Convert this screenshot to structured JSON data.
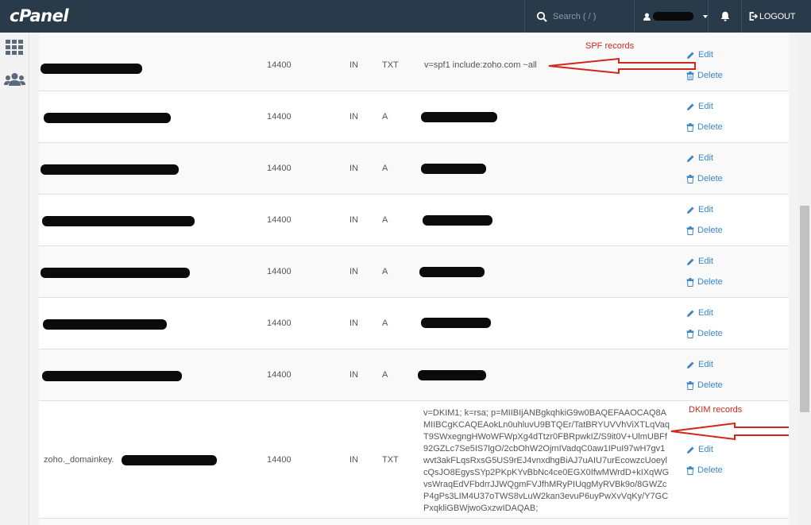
{
  "header": {
    "logo": "cPanel",
    "search_placeholder": "Search ( / )",
    "logout_label": "LOGOUT"
  },
  "sidebar": {
    "items": [
      "apps-grid-icon",
      "users-icon"
    ]
  },
  "actions": {
    "edit": "Edit",
    "delete": "Delete"
  },
  "annotations": {
    "spf": "SPF records",
    "dkim": "DKIM records"
  },
  "records": [
    {
      "name": "",
      "ttl": "14400",
      "class": "IN",
      "type": "TXT",
      "value": "v=spf1 include:zoho.com ~all"
    },
    {
      "name": "",
      "ttl": "14400",
      "class": "IN",
      "type": "A",
      "value": ""
    },
    {
      "name": "",
      "ttl": "14400",
      "class": "IN",
      "type": "A",
      "value": ""
    },
    {
      "name": "",
      "ttl": "14400",
      "class": "IN",
      "type": "A",
      "value": ""
    },
    {
      "name": "",
      "ttl": "14400",
      "class": "IN",
      "type": "A",
      "value": ""
    },
    {
      "name": "",
      "ttl": "14400",
      "class": "IN",
      "type": "A",
      "value": ""
    },
    {
      "name": "",
      "ttl": "14400",
      "class": "IN",
      "type": "A",
      "value": ""
    },
    {
      "name": "zoho._domainkey.",
      "ttl": "14400",
      "class": "IN",
      "type": "TXT",
      "value": "v=DKIM1; k=rsa; p=MIIBIjANBgkqhkiG9w0BAQEFAAOCAQ8AMIIBCgKCAQEAokLn0uhluvU9BTQEr/TatBRYUVVhViXTLqVaqT9SWxegngHWoWFWpXg4dTtzr0FBRpwkIZ/S9it0V+UlmUBFf92GZLc7Se5IS7lgO/2cbOhW2OjmIVadqC0aw1IPuI97wH7gv1wvt3akFLqsRxsG5US9rEJ4vnxdhgBiAJ7uAIU7urEcowzcUoeylcQsJO8EgysSYp2PKpKYvBbNc4ce0EGX0IfwMWrdD+kIXqWGvsWraqEdVFbdrrJJWQgmFVJfhMRyPIUqgMyRVBk9o/8GWZcP4gPs3LIM4U37oTWS8vLuW2kan3evuP6uyPwXvVqKy/Y7GCPxqkliGBWjwoGxzwIDAQAB;"
    }
  ]
}
